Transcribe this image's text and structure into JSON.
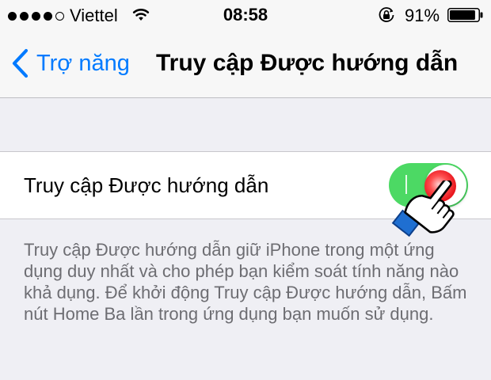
{
  "status_bar": {
    "carrier": "Viettel",
    "time": "08:58",
    "battery_percent": "91%",
    "signal_bars_filled": 4,
    "signal_bars_total": 5,
    "battery_level": 0.91,
    "icons": [
      "signal-dots-icon",
      "wifi-icon",
      "orientation-lock-icon",
      "battery-icon"
    ]
  },
  "nav": {
    "back_label": "Trợ năng",
    "title": "Truy cập Được hướng dẫn"
  },
  "setting": {
    "label": "Truy cập Được hướng dẫn",
    "toggle_on": true
  },
  "footer": {
    "text": "Truy cập Được hướng dẫn giữ iPhone trong một ứng dụng duy nhất và cho phép bạn kiểm soát tính năng nào khả dụng. Để khởi động Truy cập Được hướng dẫn, Bấm nút Home Ba lần trong ứng dụng bạn muốn sử dụng."
  },
  "colors": {
    "accent": "#007aff",
    "toggle_on": "#4cd964",
    "background": "#efeff4",
    "footer_text": "#6d6d72",
    "tap_marker": "#e8141c",
    "hand_cuff": "#1f6fd1"
  }
}
